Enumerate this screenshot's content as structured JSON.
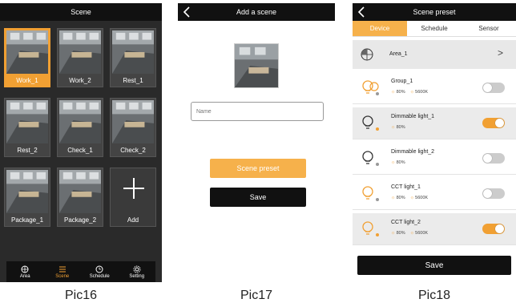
{
  "pic16": {
    "title": "Scene",
    "tiles": [
      {
        "label": "Work_1",
        "selected": true
      },
      {
        "label": "Work_2"
      },
      {
        "label": "Rest_1"
      },
      {
        "label": "Rest_2"
      },
      {
        "label": "Check_1"
      },
      {
        "label": "Check_2"
      },
      {
        "label": "Package_1"
      },
      {
        "label": "Package_2"
      }
    ],
    "add_label": "Add",
    "tabs": [
      {
        "label": "Area",
        "icon": "area-icon"
      },
      {
        "label": "Scene",
        "icon": "scene-icon",
        "active": true
      },
      {
        "label": "Schedule",
        "icon": "clock-icon"
      },
      {
        "label": "Setting",
        "icon": "gear-icon"
      }
    ],
    "colors": {
      "accent": "#f1a033",
      "background": "#2a2a2a"
    }
  },
  "pic17": {
    "title": "Add a scene",
    "name_placeholder": "Name",
    "preset_button": "Scene preset",
    "save_button": "Save"
  },
  "pic18": {
    "title": "Scene preset",
    "segments": [
      "Device",
      "Schedule",
      "Sensor"
    ],
    "active_segment": "Device",
    "area": {
      "label": "Area_1",
      "chevron": ">"
    },
    "devices": [
      {
        "name": "Group_1",
        "brightness": "80%",
        "cct": "5600K",
        "on": false,
        "highlight": false,
        "type": "group"
      },
      {
        "name": "Dimmable light_1",
        "brightness": "80%",
        "cct": "",
        "on": true,
        "highlight": true,
        "type": "dimmable"
      },
      {
        "name": "Dimmable light_2",
        "brightness": "80%",
        "cct": "",
        "on": false,
        "highlight": false,
        "type": "dimmable"
      },
      {
        "name": "CCT light_1",
        "brightness": "80%",
        "cct": "5600K",
        "on": false,
        "highlight": false,
        "type": "cct"
      },
      {
        "name": "CCT light_2",
        "brightness": "80%",
        "cct": "5600K",
        "on": true,
        "highlight": true,
        "type": "cct"
      }
    ],
    "save_button": "Save"
  },
  "captions": [
    "Pic16",
    "Pic17",
    "Pic18"
  ]
}
